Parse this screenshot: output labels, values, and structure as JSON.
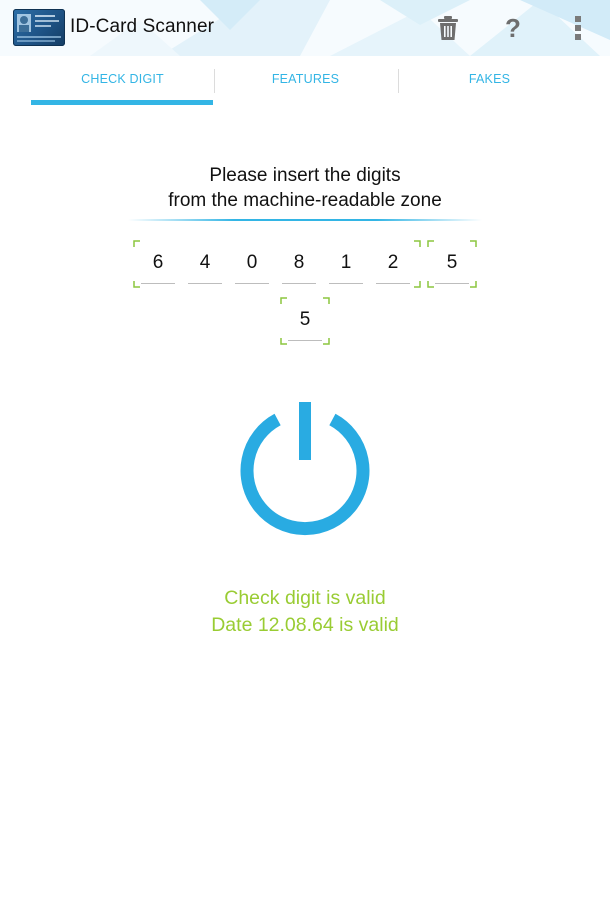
{
  "app": {
    "title": "ID-Card Scanner",
    "icons": [
      "id-card-app-icon",
      "trash-icon",
      "help-icon",
      "overflow-menu-icon"
    ],
    "help_glyph": "?"
  },
  "tabs": [
    {
      "label": "CHECK DIGIT",
      "selected": true
    },
    {
      "label": "FEATURES",
      "selected": false
    },
    {
      "label": "FAKES",
      "selected": false
    }
  ],
  "instruction": {
    "line1": "Please insert the digits",
    "line2": "from the machine-readable zone"
  },
  "digits": {
    "date_digits": [
      "6",
      "4",
      "0",
      "8",
      "1",
      "2"
    ],
    "date_check_digit": "5",
    "overall_check_digit": "5"
  },
  "status": {
    "line1": "Check digit is valid",
    "line2": "Date 12.08.64 is valid"
  },
  "colors": {
    "accent": "#33b5e5",
    "valid": "#99cc33",
    "bracket": "#8cc63f"
  }
}
